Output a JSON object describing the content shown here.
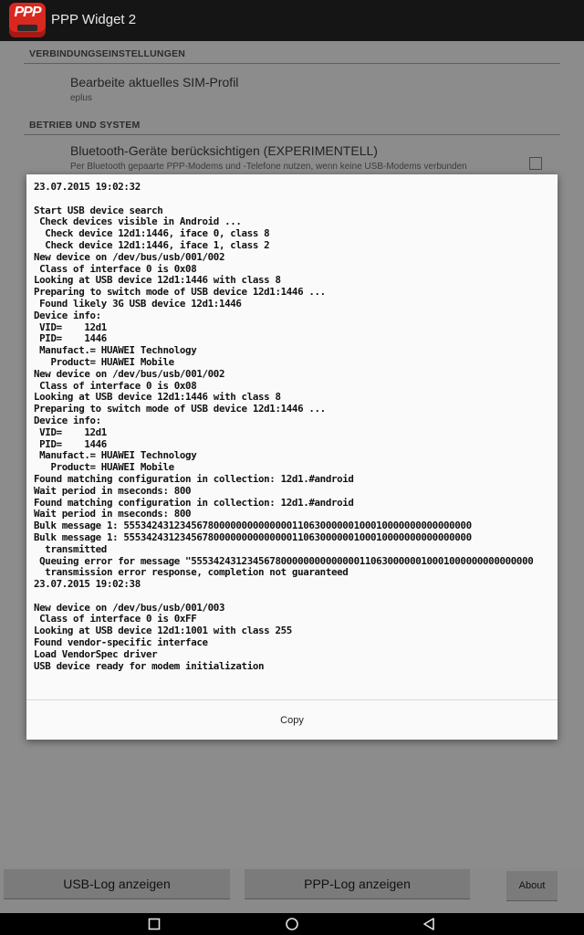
{
  "app": {
    "icon_text": "PPP",
    "title": "PPP Widget 2"
  },
  "settings": {
    "section1_header": "VERBINDUNGSEINSTELLUNGEN",
    "sim_profile_title": "Bearbeite aktuelles SIM-Profil",
    "sim_profile_summary": "eplus",
    "section2_header": "BETRIEB UND SYSTEM",
    "bluetooth_title": "Bluetooth-Geräte berücksichtigen (EXPERIMENTELL)",
    "bluetooth_summary": "Per Bluetooth gepaarte PPP-Modems und -Telefone nutzen, wenn keine USB-Modems verbunden"
  },
  "dialog": {
    "log_lines": [
      "23.07.2015 19:02:32",
      "",
      "Start USB device search",
      " Check devices visible in Android ...",
      "  Check device 12d1:1446, iface 0, class 8",
      "  Check device 12d1:1446, iface 1, class 2",
      "New device on /dev/bus/usb/001/002",
      " Class of interface 0 is 0x08",
      "Looking at USB device 12d1:1446 with class 8",
      "Preparing to switch mode of USB device 12d1:1446 ...",
      " Found likely 3G USB device 12d1:1446",
      "Device info:",
      " VID=    12d1",
      " PID=    1446",
      " Manufact.= HUAWEI Technology",
      "   Product= HUAWEI Mobile",
      "New device on /dev/bus/usb/001/002",
      " Class of interface 0 is 0x08",
      "Looking at USB device 12d1:1446 with class 8",
      "Preparing to switch mode of USB device 12d1:1446 ...",
      "Device info:",
      " VID=    12d1",
      " PID=    1446",
      " Manufact.= HUAWEI Technology",
      "   Product= HUAWEI Mobile",
      "Found matching configuration in collection: 12d1.#android",
      "Wait period in mseconds: 800",
      "Found matching configuration in collection: 12d1.#android",
      "Wait period in mseconds: 800",
      "Bulk message 1: 55534243123456780000000000000011063000000100010000000000000000",
      "Bulk message 1: 55534243123456780000000000000011063000000100010000000000000000",
      "  transmitted",
      " Queuing error for message \"5553424312345678000000000000001106300000010001000000000000000",
      "  transmission error response, completion not guaranteed",
      "23.07.2015 19:02:38",
      "",
      "New device on /dev/bus/usb/001/003",
      " Class of interface 0 is 0xFF",
      "Looking at USB device 12d1:1001 with class 255",
      "Found vendor-specific interface",
      "Load VendorSpec driver",
      "USB device ready for modem initialization"
    ],
    "copy_label": "Copy"
  },
  "buttons": {
    "usb_log": "USB-Log anzeigen",
    "ppp_log": "PPP-Log anzeigen",
    "about": "About"
  },
  "navbar": {
    "icons": [
      "recents-icon",
      "home-icon",
      "back-icon"
    ]
  },
  "colors": {
    "app_icon": "#d8281f",
    "dim_background": "#8a8a8a",
    "dialog_background": "#fafafa"
  }
}
